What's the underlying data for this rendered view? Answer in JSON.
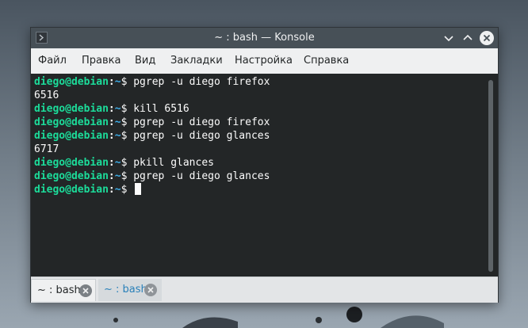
{
  "window": {
    "title": "~ : bash — Konsole",
    "icon": "terminal-icon"
  },
  "titlebar_buttons": [
    "minimize-icon",
    "maximize-icon",
    "close-icon"
  ],
  "menu": [
    {
      "label": "Файл"
    },
    {
      "label": "Правка"
    },
    {
      "label": "Вид"
    },
    {
      "label": "Закладки"
    },
    {
      "label": "Настройка"
    },
    {
      "label": "Справка"
    }
  ],
  "terminal": {
    "prompt_user": "diego@debian",
    "prompt_colon": ":",
    "prompt_dir": "~",
    "prompt_symbol": "$ ",
    "lines": [
      {
        "prompt": true,
        "command": "pgrep -u diego firefox"
      },
      {
        "prompt": false,
        "output": "6516"
      },
      {
        "prompt": true,
        "command": "kill 6516"
      },
      {
        "prompt": true,
        "command": "pgrep -u diego firefox"
      },
      {
        "prompt": true,
        "command": "pgrep -u diego glances"
      },
      {
        "prompt": false,
        "output": "6717"
      },
      {
        "prompt": true,
        "command": "pkill glances"
      },
      {
        "prompt": true,
        "command": "pgrep -u diego glances"
      },
      {
        "prompt": true,
        "command": ""
      }
    ]
  },
  "tabs": [
    {
      "label": "~ : bash",
      "active": true
    },
    {
      "label": "~ : bash",
      "active": false
    }
  ],
  "colors": {
    "terminal_bg": "#232627",
    "prompt_user": "#1cdc9a",
    "prompt_dir": "#3daee9",
    "titlebar": "#475057",
    "inactive_tab_text": "#2980b9"
  }
}
